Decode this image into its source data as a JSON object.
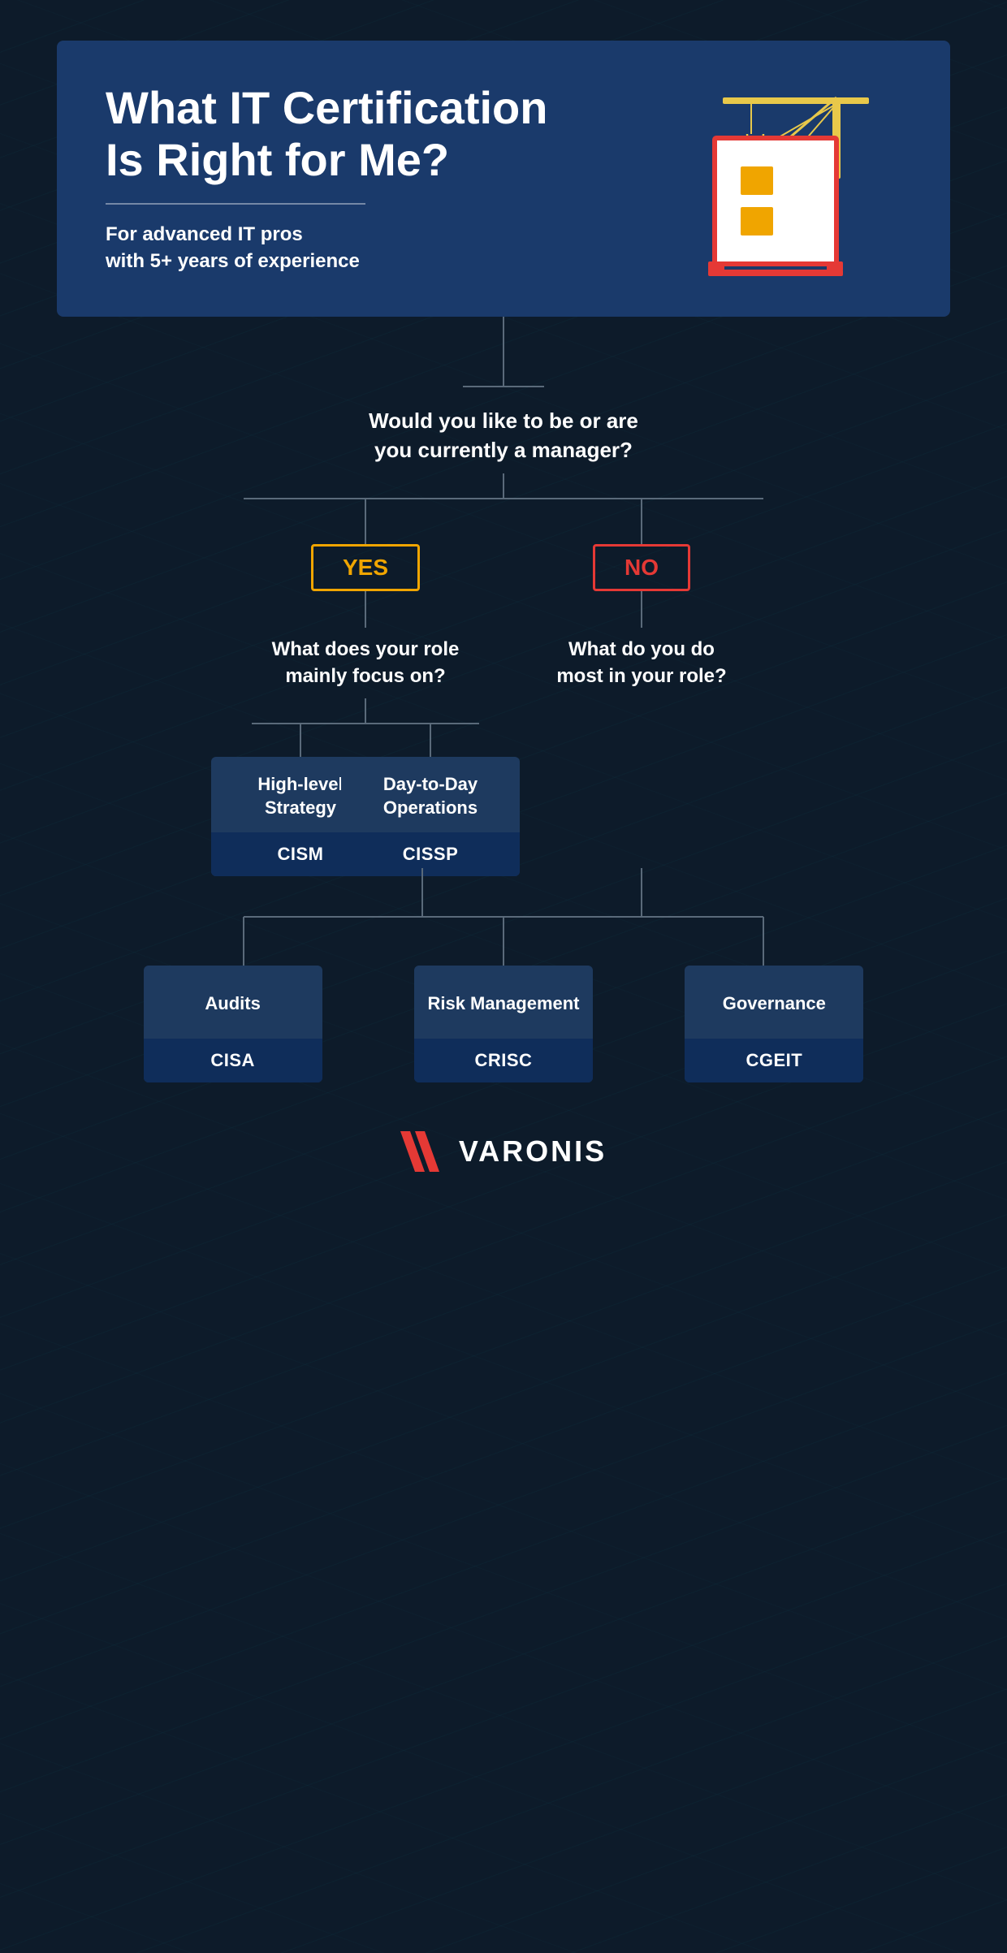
{
  "header": {
    "title": "What IT Certification Is Right for Me?",
    "subtitle": "For advanced IT pros\nwith 5+ years of experience"
  },
  "flowchart": {
    "question1": "Would you like to be or are\nyou currently a manager?",
    "yes_label": "YES",
    "no_label": "NO",
    "yes_question": "What does your role\nmainly focus on?",
    "no_question": "What do you do\nmost in your role?",
    "yes_options": [
      {
        "label": "High-level Strategy",
        "cert": "CISM"
      },
      {
        "label": "Day-to-Day Operations",
        "cert": "CISSP"
      }
    ],
    "no_options": [
      {
        "label": "Audits",
        "cert": "CISA"
      },
      {
        "label": "Risk Management",
        "cert": "CRISC"
      },
      {
        "label": "Governance",
        "cert": "CGEIT"
      }
    ]
  },
  "logo": {
    "text": "VARONIS"
  }
}
